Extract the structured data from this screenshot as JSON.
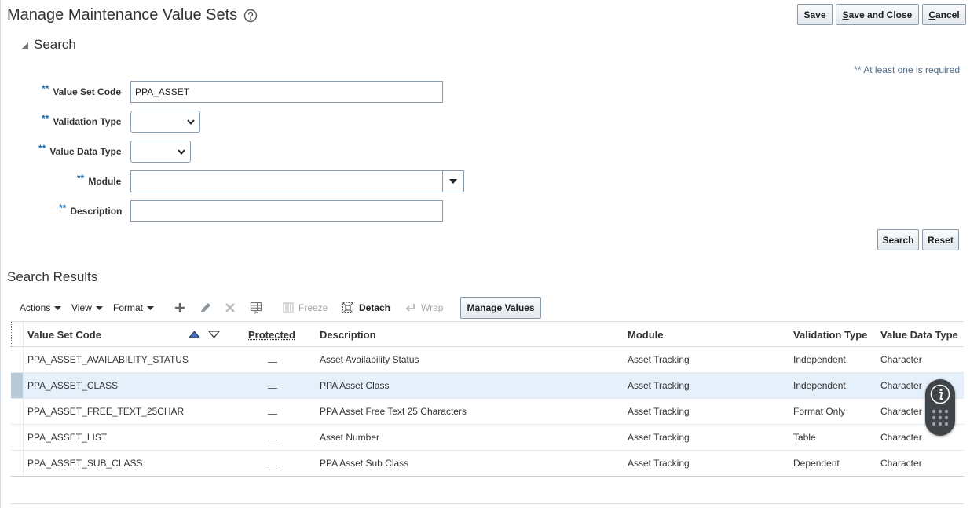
{
  "page": {
    "title": "Manage Maintenance Value Sets",
    "save": "Save",
    "save_and_close_prefix": "S",
    "save_and_close_rest": "ave and Close",
    "cancel_prefix": "C",
    "cancel_rest": "ancel"
  },
  "search": {
    "heading": "Search",
    "required_note": "** At least one is required",
    "required_marker": "**",
    "fields": {
      "value_set_code": {
        "label": "Value Set Code",
        "value": "PPA_ASSET"
      },
      "validation_type": {
        "label": "Validation Type",
        "value": ""
      },
      "value_data_type": {
        "label": "Value Data Type",
        "value": ""
      },
      "module": {
        "label": "Module",
        "value": ""
      },
      "description": {
        "label": "Description",
        "value": ""
      }
    },
    "search_button": "Search",
    "reset_button": "Reset"
  },
  "results": {
    "heading": "Search Results",
    "toolbar": {
      "actions": "Actions",
      "view": "View",
      "format": "Format",
      "freeze": "Freeze",
      "detach": "Detach",
      "wrap": "Wrap",
      "manage_values": "Manage Values"
    },
    "columns": {
      "code": "Value Set Code",
      "protected": "Protected",
      "description": "Description",
      "module": "Module",
      "validation_type": "Validation Type",
      "value_data_type": "Value Data Type"
    },
    "rows": [
      {
        "code": "PPA_ASSET_AVAILABILITY_STATUS",
        "description": "Asset Availability Status",
        "module": "Asset Tracking",
        "validation_type": "Independent",
        "value_data_type": "Character"
      },
      {
        "code": "PPA_ASSET_CLASS",
        "description": "PPA Asset Class",
        "module": "Asset Tracking",
        "validation_type": "Independent",
        "value_data_type": "Character"
      },
      {
        "code": "PPA_ASSET_FREE_TEXT_25CHAR",
        "description": "PPA Asset Free Text 25 Characters",
        "module": "Asset Tracking",
        "validation_type": "Format Only",
        "value_data_type": "Character"
      },
      {
        "code": "PPA_ASSET_LIST",
        "description": "Asset Number",
        "module": "Asset Tracking",
        "validation_type": "Table",
        "value_data_type": "Character"
      },
      {
        "code": "PPA_ASSET_SUB_CLASS",
        "description": "PPA Asset Sub Class",
        "module": "Asset Tracking",
        "validation_type": "Dependent",
        "value_data_type": "Character"
      }
    ],
    "selected_row": 1
  },
  "icons": {
    "help": "help-circle-icon",
    "disclosure": "disclosure-triangle-icon",
    "add": "plus-icon",
    "edit": "pencil-icon",
    "delete": "x-icon",
    "query_by_example": "query-by-example-icon",
    "freeze": "freeze-icon",
    "detach": "detach-icon",
    "wrap": "wrap-icon",
    "sort_asc": "sort-ascending-icon",
    "sort_desc": "sort-descending-icon",
    "info": "info-icon",
    "keypad": "keypad-icon"
  },
  "colors": {
    "required": "#1d6aa8",
    "selected_row": "#e5f0fb",
    "note": "#4f6b86"
  }
}
